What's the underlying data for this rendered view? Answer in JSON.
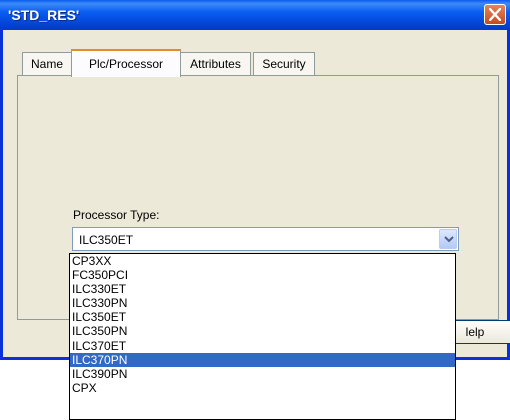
{
  "window": {
    "title": "'STD_RES'"
  },
  "tabs": [
    {
      "label": "Name",
      "active": false
    },
    {
      "label": "Plc/Processor",
      "active": true
    },
    {
      "label": "Attributes",
      "active": false
    },
    {
      "label": "Security",
      "active": false
    }
  ],
  "processor": {
    "label": "Processor Type:",
    "value": "ILC350ET",
    "options": [
      "CP3XX",
      "FC350PCI",
      "ILC330ET",
      "ILC330PN",
      "ILC350ET",
      "ILC350PN",
      "ILC370ET",
      "ILC370PN",
      "ILC390PN",
      "CPX"
    ],
    "highlighted": "ILC370PN"
  },
  "buttons": {
    "help_partial": "lelp"
  },
  "icons": {
    "close": "close-icon",
    "dropdown": "chevron-down-icon"
  },
  "colors": {
    "titlebar": "#0a5ef3",
    "close": "#c64b1f",
    "selection": "#316ac5",
    "active_tab_accent": "#e68b2c",
    "dialog_bg": "#ece9d8"
  }
}
